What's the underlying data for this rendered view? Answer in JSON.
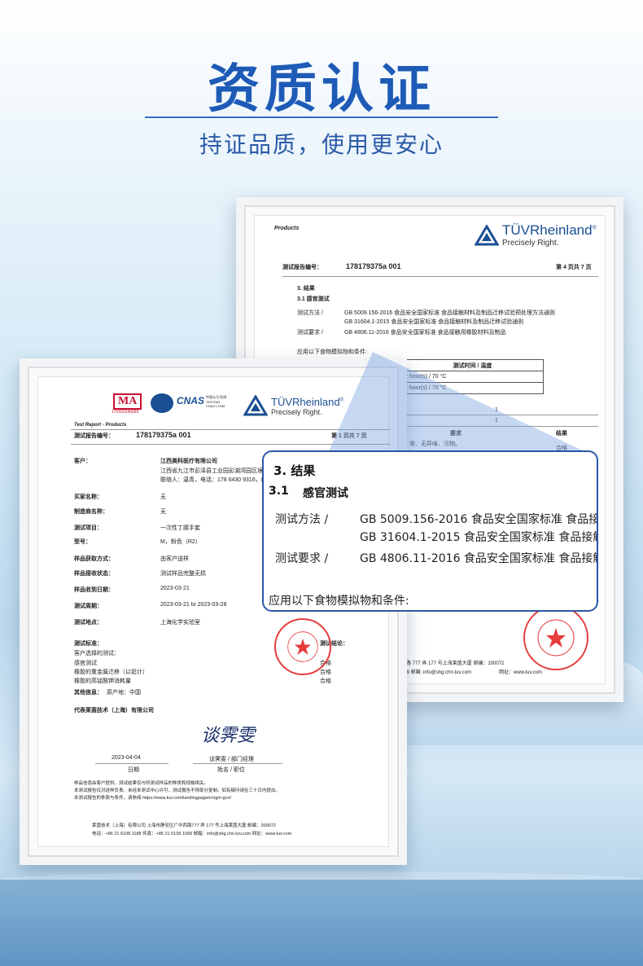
{
  "header": {
    "title": "资质认证",
    "subtitle": "持证品质，使用更安心"
  },
  "back_cert": {
    "products_label": "Products",
    "tuv_name": "TÜVRheinland",
    "tuv_reg": "®",
    "tuv_slogan": "Precisely Right.",
    "report_no_label": "测试报告编号：",
    "report_no": "178179375a 001",
    "page": "第 4 页共 7 页",
    "sec3": "3.  结果",
    "sec31": "3.1    感官测试",
    "method_label": "测试方法 /",
    "method1": "GB 5009.156-2016  食品安全国家标准  食品接触材料及制品迁移试验预处理方法通则",
    "method2": "GB 31604.1-2015  食品安全国家标准  食品接触材料及制品迁移试验通则",
    "req_label": "测试要求 /",
    "req1": "GB 4806.11-2016  食品安全国家标准  食品接触用橡胶材料及制品",
    "sim_label": "应用以下食物模拟物和条件:",
    "table_head": "测试时间 / 温度",
    "time1": "2 hour(s) / 70 °C",
    "time2": "2 hour(s) / 70 °C",
    "n1": "1",
    "n2": "1",
    "req_col": "要求",
    "result_col": "结果",
    "no_odor": "常、无异味、污物。",
    "pass": "合格",
    "address": "西路 777 弄 177 号上海莱茵大厦   邮编：200072",
    "email": "099       邮箱: info@shg.chn.tuv.com",
    "web": "网址：www.tuv.com"
  },
  "front_cert": {
    "ma": "MA",
    "ma_no": "170920340689",
    "cnas": "CNAS",
    "cnas_sub": "中国认可 检测 TESTING CNAS L1936",
    "test_report": "Test Report - Products",
    "tuv_name": "TÜVRheinland",
    "tuv_reg": "®",
    "tuv_slogan": "Precisely Right.",
    "report_no_label": "测试报告编号：",
    "report_no": "178179375a 001",
    "page": "第 1 页共 7 页",
    "client_label": "客户：",
    "client_name": "江西美科医疗有限公司",
    "client_addr": "江西省九江市彭泽县工业园彭湖湾园区境太",
    "client_contact": "联络人：温青，电话：178 6430 9316，邮",
    "buyer_label": "买家名称：",
    "buyer": "无",
    "maker_label": "制造商名称：",
    "maker": "无",
    "item_label": "测试项目：",
    "item": "一次性丁腈手套",
    "model_label": "型号：",
    "model": "M，粉色（R2）",
    "obtain_label": "样品获取方式：",
    "obtain": "由客户送样",
    "state_label": "样品接收状态：",
    "state": "测试样品完整无损",
    "recv_label": "样品收到日期：",
    "recv": "2023-03-21",
    "period_label": "测试周期：",
    "period": "2023-03-21 to 2023-03-28",
    "place_label": "测试地点：",
    "place": "上海化学实验室",
    "tests_label": "测试标准：",
    "conclusion_label": "测试结论：",
    "client_sel": "客户选择的测试：",
    "test1": "感官测试",
    "test2": "橡胶的重金属迁移（以铅计）",
    "test3": "橡胶的高锰酸钾消耗量",
    "pass1": "合格",
    "pass2": "合格",
    "pass3": "合格",
    "other_label": "其他信息：",
    "other": "原产地：中国",
    "signer_org": "代表莱茵技术（上海）有限公司",
    "signature": "谈霁雯",
    "date": "2023-04-04",
    "date_label": "日期",
    "signer": "谈霁雯 / 部门经理",
    "signer_label": "姓名 / 职位",
    "note1": "样品信息由客户提供。测试结果仅与所测试样品的种类和规格相关。",
    "note2": "本测试报告仅对送样负责。未经本测试中心许可，测试报告不得部分复制。如有疑问请在三十日内提出。",
    "note3": "本测试报告的条款与条件，请参阅 https://www.tuv.com/landingpage/en/gm-gcn/",
    "company": "莱茵技术（上海）有限公司     上海市静安区广中西路777 弄 177 号上海莱茵大厦    邮编：200072",
    "phone": "电话：+86 21 6108 1188     传真：+86 21 6108 1099     邮箱：info@shg.chn.tuv.com                         网址：www.tuv.com"
  },
  "callout": {
    "h1": "3.  结果",
    "h2_num": "3.1",
    "h2": "感官测试",
    "method_label": "测试方法  /",
    "method1": "GB 5009.156-2016  食品安全国家标准  食品接",
    "method2": "GB 31604.1-2015  食品安全国家标准  食品接触",
    "req_label": "测试要求  /",
    "req1": "GB 4806.11-2016  食品安全国家标准  食品接触",
    "foot": "应用以下食物模拟物和条件:"
  },
  "colors": {
    "title_blue": "#1e5bb7",
    "tuv_blue": "#1b4f93",
    "seal_red": "#e53c3c",
    "callout_border": "#2a57a8"
  }
}
